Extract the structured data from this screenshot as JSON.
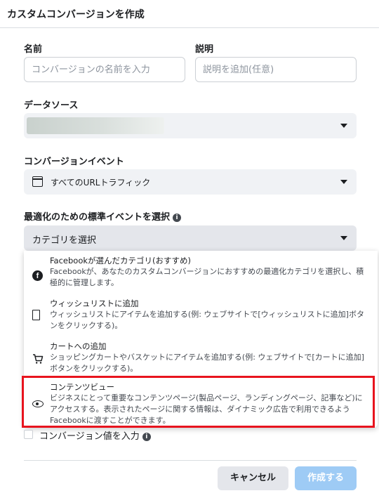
{
  "dialog": {
    "title": "カスタムコンバージョンを作成"
  },
  "form": {
    "name_label": "名前",
    "name_placeholder": "コンバージョンの名前を入力",
    "desc_label": "説明",
    "desc_placeholder": "説明を追加(任意)",
    "datasource_label": "データソース",
    "event_label": "コンバージョンイベント",
    "event_value": "すべてのURLトラフィック",
    "optimize_label": "最適化のための標準イベントを選択",
    "category_value": "カテゴリを選択",
    "value_checkbox_label": "コンバージョン値を入力"
  },
  "dropdown": {
    "options": [
      {
        "title": "Facebookが選んだカテゴリ(おすすめ)",
        "description": "Facebookが、あなたのカスタムコンバージョンにおすすめの最適化カテゴリを選択し、積極的に管理します。",
        "icon": "facebook-icon"
      },
      {
        "title": "ウィッシュリストに追加",
        "description": "ウィッシュリストにアイテムを追加する(例: ウェブサイトで[ウィッシュリストに追加]ボタンをクリックする)。",
        "icon": "bookmark-icon"
      },
      {
        "title": "カートへの追加",
        "description": "ショッピングカートやバスケットにアイテムを追加する(例: ウェブサイトで[カートに追加]ボタンをクリックする)。",
        "icon": "cart-icon"
      },
      {
        "title": "コンテンツビュー",
        "description": "ビジネスにとって重要なコンテンツページ(製品ページ、ランディングページ、記事など)にアクセスする。表示されたページに関する情報は、ダイナミック広告で利用できるようFacebookに渡すことができます。",
        "icon": "eye-icon",
        "highlighted": true
      }
    ]
  },
  "buttons": {
    "cancel": "キャンセル",
    "create": "作成する"
  },
  "colors": {
    "highlight": "#e8141e",
    "create_button": "#9ecbf5",
    "select_bg": "#f0f2f5"
  }
}
